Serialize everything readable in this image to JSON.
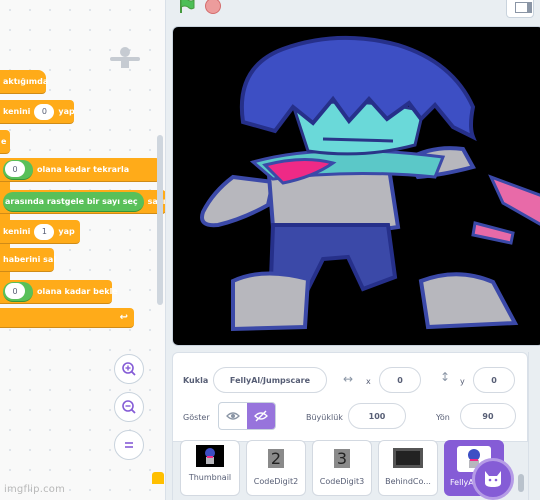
{
  "code": {
    "blocks": [
      {
        "text": "aktığımda"
      },
      {
        "text_before": "kenini",
        "value": "0",
        "text_after": "yap"
      },
      {
        "text": "e"
      },
      {
        "value": "0",
        "text_after": "olana kadar tekrarla"
      },
      {
        "text": "arasında rastgele bir sayı seç",
        "text_after": "sayı"
      },
      {
        "text_before": "kenini",
        "value": "1",
        "text_after": "yap"
      },
      {
        "text": "haberini sal"
      },
      {
        "value": "0",
        "text_after": "olana kadar bekle"
      }
    ],
    "zoom_in_icon": "zoom-in-icon",
    "zoom_out_icon": "zoom-out-icon",
    "zoom_reset_icon": "equals-icon"
  },
  "controls": {
    "green_flag_icon": "green-flag-icon",
    "stop_icon": "stop-icon"
  },
  "sprite_info": {
    "sprite_label": "Kukla",
    "sprite_name": "FellyAl/Jumpscare",
    "x_label": "x",
    "x_value": "0",
    "y_label": "y",
    "y_value": "0",
    "show_label": "Göster",
    "size_label": "Büyüklük",
    "size_value": "100",
    "direction_label": "Yön",
    "direction_value": "90"
  },
  "sprites": [
    {
      "name": "Thumbnail"
    },
    {
      "name": "CodeDigit2",
      "glyph": "2"
    },
    {
      "name": "CodeDigit3",
      "glyph": "3"
    },
    {
      "name": "BehindCo..."
    },
    {
      "name": "FellyA"
    }
  ],
  "watermark": "imgflip.com",
  "colors": {
    "accent": "#855cd6",
    "control": "#ffab19",
    "operator": "#59c059"
  }
}
